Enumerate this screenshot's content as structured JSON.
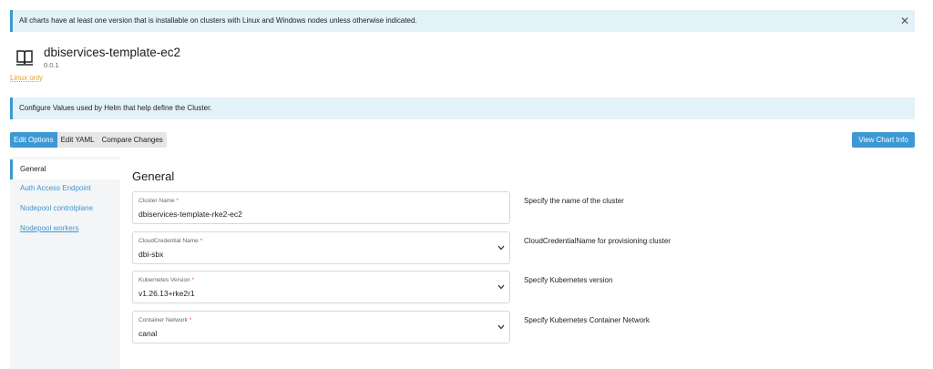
{
  "banner": {
    "text": "All charts have at least one version that is installable on clusters with Linux and Windows nodes unless otherwise indicated.",
    "close_label": "✕"
  },
  "chart": {
    "name": "dbiservices-template-ec2",
    "version": "0.0.1",
    "os_only": "Linux only"
  },
  "info": {
    "text": "Configure Values used by Helm that help define the Cluster."
  },
  "tabs": [
    {
      "label": "Edit Options"
    },
    {
      "label": "Edit YAML"
    },
    {
      "label": "Compare Changes"
    }
  ],
  "view_chart_info": "View Chart Info",
  "sidebar": {
    "items": [
      {
        "label": "General"
      },
      {
        "label": "Auth Access Endpoint"
      },
      {
        "label": "Nodepool controlplane"
      },
      {
        "label": "Nodepool workers"
      }
    ]
  },
  "form": {
    "title": "General",
    "required_marker": "*",
    "fields": [
      {
        "label": "Cluster Name",
        "value": "dbiservices-template-rke2-ec2",
        "description": "Specify the name of the cluster"
      },
      {
        "label": "CloudCredential Name",
        "value": "dbi-sbx",
        "description": "CloudCredentialName for provisioning cluster"
      },
      {
        "label": "Kubernetes Version",
        "value": "v1.26.13+rke2r1",
        "description": "Specify Kubernetes version"
      },
      {
        "label": "Container Network",
        "value": "canal",
        "description": "Specify Kubernetes Container Network"
      }
    ]
  },
  "colors": {
    "accent": "#3d98d3",
    "banner_bg": "#e3f2f8",
    "warning": "#e1a12b",
    "required": "#e74c3c"
  },
  "icons": {
    "chart": "book-icon",
    "close": "close-icon",
    "dropdown": "chevron-down-icon"
  }
}
